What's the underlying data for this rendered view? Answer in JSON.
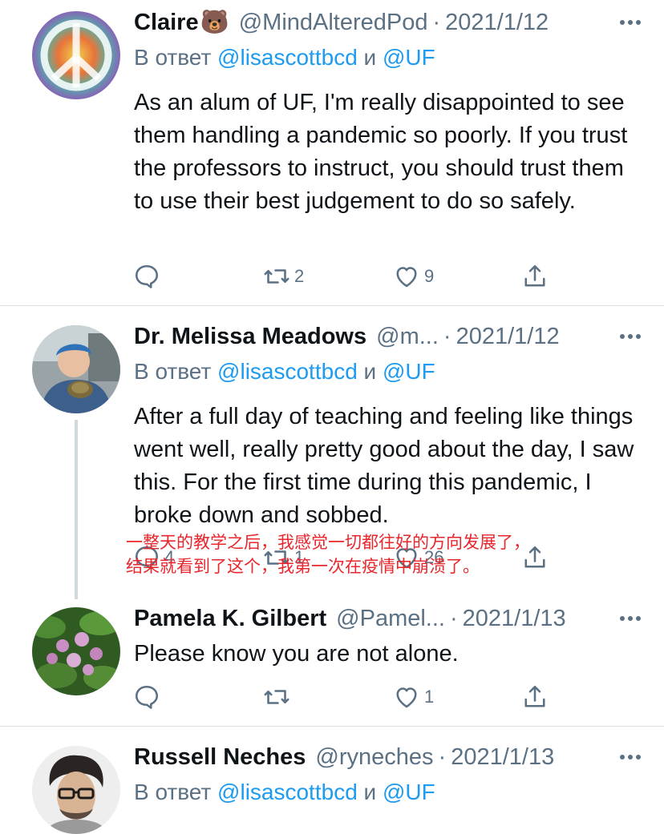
{
  "tweets": [
    {
      "name": "Claire",
      "emoji": "🐻",
      "handle": "@MindAlteredPod",
      "separator": "·",
      "date": "2021/1/12",
      "reply_prefix": "В ответ",
      "reply_user1": "@lisascottbcd",
      "reply_and": "и",
      "reply_user2": "@UF",
      "text": "As an alum of UF, I'm really disappointed to see them handling a pandemic so poorly. If you trust the professors to instruct, you should trust them to use their best judgement to do so safely.",
      "reply_count": "",
      "retweet_count": "2",
      "like_count": "9"
    },
    {
      "name": "Dr. Melissa Meadows",
      "handle": "@m...",
      "separator": "·",
      "date": "2021/1/12",
      "reply_prefix": "В ответ",
      "reply_user1": "@lisascottbcd",
      "reply_and": "и",
      "reply_user2": "@UF",
      "text": "After a full day of teaching and feeling like things went well, really pretty good about the day, I saw this. For the first time during this pandemic, I broke down and sobbed.",
      "reply_count": "4",
      "retweet_count": "1",
      "like_count": "26"
    },
    {
      "name": "Pamela K. Gilbert",
      "handle": "@Pamel...",
      "separator": "·",
      "date": "2021/1/13",
      "text": "Please know you are not alone.",
      "reply_count": "",
      "retweet_count": "",
      "like_count": "1"
    },
    {
      "name": "Russell Neches",
      "handle": "@ryneches",
      "separator": "·",
      "date": "2021/1/13",
      "reply_prefix": "В ответ",
      "reply_user1": "@lisascottbcd",
      "reply_and": "и",
      "reply_user2": "@UF"
    }
  ],
  "translation_overlay": {
    "line1": "一整天的教学之后，我感觉一切都往好的方向发展了，",
    "line2": "结果就看到了这个，我第一次在疫情中崩溃了。"
  },
  "icons": {
    "more": "more-horizontal-icon",
    "reply": "reply-bubble-icon",
    "retweet": "retweet-icon",
    "like": "heart-icon",
    "share": "share-icon"
  },
  "colors": {
    "link": "#1d9bf0",
    "muted": "#5b7083",
    "overlay_text": "#e8262b"
  }
}
